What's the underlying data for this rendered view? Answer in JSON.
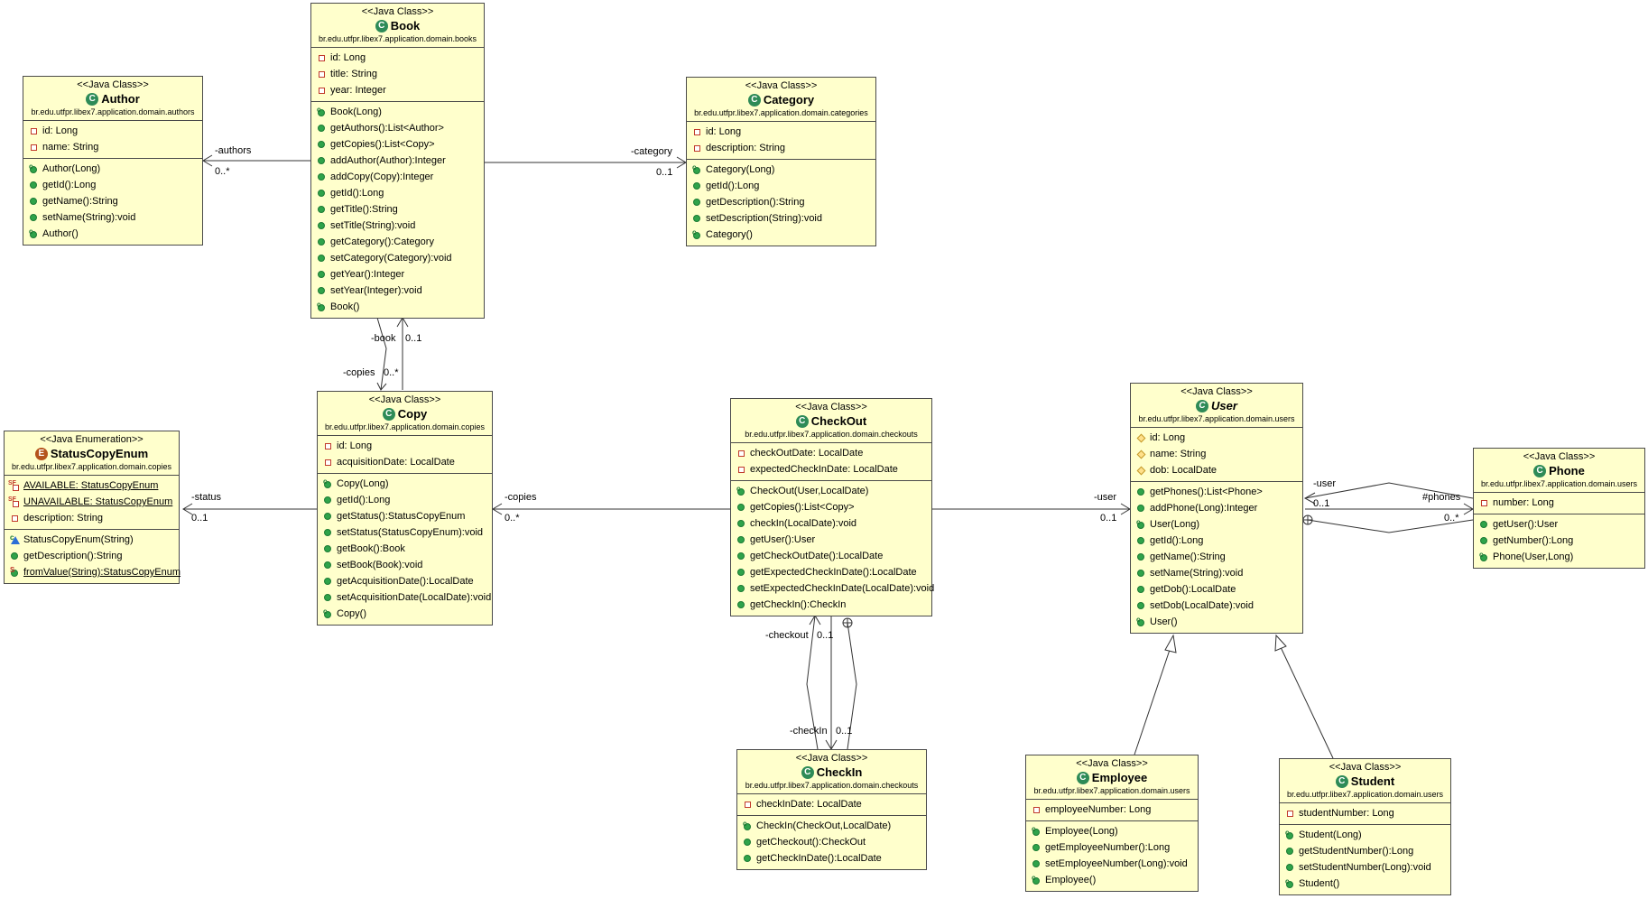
{
  "classes": [
    {
      "key": "author",
      "stereotype": "<<Java Class>>",
      "kind": "class",
      "name": "Author",
      "package": "br.edu.utfpr.libex7.application.domain.authors",
      "attributes": [
        {
          "v": "priv",
          "t": "id: Long"
        },
        {
          "v": "priv",
          "t": "name: String"
        }
      ],
      "methods": [
        {
          "v": "ctor",
          "t": "Author(Long)"
        },
        {
          "v": "pub",
          "t": "getId():Long"
        },
        {
          "v": "pub",
          "t": "getName():String"
        },
        {
          "v": "pub",
          "t": "setName(String):void"
        },
        {
          "v": "ctor",
          "t": "Author()"
        }
      ]
    },
    {
      "key": "book",
      "stereotype": "<<Java Class>>",
      "kind": "class",
      "name": "Book",
      "package": "br.edu.utfpr.libex7.application.domain.books",
      "attributes": [
        {
          "v": "priv",
          "t": "id: Long"
        },
        {
          "v": "priv",
          "t": "title: String"
        },
        {
          "v": "priv",
          "t": "year: Integer"
        }
      ],
      "methods": [
        {
          "v": "ctor",
          "t": "Book(Long)"
        },
        {
          "v": "pub",
          "t": "getAuthors():List<Author>"
        },
        {
          "v": "pub",
          "t": "getCopies():List<Copy>"
        },
        {
          "v": "pub",
          "t": "addAuthor(Author):Integer"
        },
        {
          "v": "pub",
          "t": "addCopy(Copy):Integer"
        },
        {
          "v": "pub",
          "t": "getId():Long"
        },
        {
          "v": "pub",
          "t": "getTitle():String"
        },
        {
          "v": "pub",
          "t": "setTitle(String):void"
        },
        {
          "v": "pub",
          "t": "getCategory():Category"
        },
        {
          "v": "pub",
          "t": "setCategory(Category):void"
        },
        {
          "v": "pub",
          "t": "getYear():Integer"
        },
        {
          "v": "pub",
          "t": "setYear(Integer):void"
        },
        {
          "v": "ctor",
          "t": "Book()"
        }
      ]
    },
    {
      "key": "category",
      "stereotype": "<<Java Class>>",
      "kind": "class",
      "name": "Category",
      "package": "br.edu.utfpr.libex7.application.domain.categories",
      "attributes": [
        {
          "v": "priv",
          "t": "id: Long"
        },
        {
          "v": "priv",
          "t": "description: String"
        }
      ],
      "methods": [
        {
          "v": "ctor",
          "t": "Category(Long)"
        },
        {
          "v": "pub",
          "t": "getId():Long"
        },
        {
          "v": "pub",
          "t": "getDescription():String"
        },
        {
          "v": "pub",
          "t": "setDescription(String):void"
        },
        {
          "v": "ctor",
          "t": "Category()"
        }
      ]
    },
    {
      "key": "statuscopyenum",
      "stereotype": "<<Java Enumeration>>",
      "kind": "enum",
      "name": "StatusCopyEnum",
      "package": "br.edu.utfpr.libex7.application.domain.copies",
      "attributes": [
        {
          "v": "sfield",
          "t": "AVAILABLE: StatusCopyEnum",
          "static": true
        },
        {
          "v": "sfield",
          "t": "UNAVAILABLE: StatusCopyEnum",
          "static": true
        },
        {
          "v": "priv",
          "t": "description: String"
        }
      ],
      "methods": [
        {
          "v": "pctor",
          "t": "StatusCopyEnum(String)"
        },
        {
          "v": "pub",
          "t": "getDescription():String"
        },
        {
          "v": "smeth",
          "t": "fromValue(String):StatusCopyEnum",
          "static": true
        }
      ]
    },
    {
      "key": "copy",
      "stereotype": "<<Java Class>>",
      "kind": "class",
      "name": "Copy",
      "package": "br.edu.utfpr.libex7.application.domain.copies",
      "attributes": [
        {
          "v": "priv",
          "t": "id: Long"
        },
        {
          "v": "priv",
          "t": "acquisitionDate: LocalDate"
        }
      ],
      "methods": [
        {
          "v": "ctor",
          "t": "Copy(Long)"
        },
        {
          "v": "pub",
          "t": "getId():Long"
        },
        {
          "v": "pub",
          "t": "getStatus():StatusCopyEnum"
        },
        {
          "v": "pub",
          "t": "setStatus(StatusCopyEnum):void"
        },
        {
          "v": "pub",
          "t": "getBook():Book"
        },
        {
          "v": "pub",
          "t": "setBook(Book):void"
        },
        {
          "v": "pub",
          "t": "getAcquisitionDate():LocalDate"
        },
        {
          "v": "pub",
          "t": "setAcquisitionDate(LocalDate):void"
        },
        {
          "v": "ctor",
          "t": "Copy()"
        }
      ]
    },
    {
      "key": "checkout",
      "stereotype": "<<Java Class>>",
      "kind": "class",
      "name": "CheckOut",
      "package": "br.edu.utfpr.libex7.application.domain.checkouts",
      "attributes": [
        {
          "v": "priv",
          "t": "checkOutDate: LocalDate"
        },
        {
          "v": "priv",
          "t": "expectedCheckInDate: LocalDate"
        }
      ],
      "methods": [
        {
          "v": "ctor",
          "t": "CheckOut(User,LocalDate)"
        },
        {
          "v": "pub",
          "t": "getCopies():List<Copy>"
        },
        {
          "v": "pub",
          "t": "checkIn(LocalDate):void"
        },
        {
          "v": "pub",
          "t": "getUser():User"
        },
        {
          "v": "pub",
          "t": "getCheckOutDate():LocalDate"
        },
        {
          "v": "pub",
          "t": "getExpectedCheckInDate():LocalDate"
        },
        {
          "v": "pub",
          "t": "setExpectedCheckInDate(LocalDate):void"
        },
        {
          "v": "pub",
          "t": "getCheckIn():CheckIn"
        }
      ]
    },
    {
      "key": "checkin",
      "stereotype": "<<Java Class>>",
      "kind": "class",
      "name": "CheckIn",
      "package": "br.edu.utfpr.libex7.application.domain.checkouts",
      "attributes": [
        {
          "v": "priv",
          "t": "checkInDate: LocalDate"
        }
      ],
      "methods": [
        {
          "v": "ctor",
          "t": "CheckIn(CheckOut,LocalDate)"
        },
        {
          "v": "pub",
          "t": "getCheckout():CheckOut"
        },
        {
          "v": "pub",
          "t": "getCheckInDate():LocalDate"
        }
      ]
    },
    {
      "key": "user",
      "stereotype": "<<Java Class>>",
      "kind": "abstract",
      "name": "User",
      "package": "br.edu.utfpr.libex7.application.domain.users",
      "attributes": [
        {
          "v": "prot",
          "t": "id: Long"
        },
        {
          "v": "prot",
          "t": "name: String"
        },
        {
          "v": "prot",
          "t": "dob: LocalDate"
        }
      ],
      "methods": [
        {
          "v": "pub",
          "t": "getPhones():List<Phone>"
        },
        {
          "v": "pub",
          "t": "addPhone(Long):Integer"
        },
        {
          "v": "ctor",
          "t": "User(Long)"
        },
        {
          "v": "pub",
          "t": "getId():Long"
        },
        {
          "v": "pub",
          "t": "getName():String"
        },
        {
          "v": "pub",
          "t": "setName(String):void"
        },
        {
          "v": "pub",
          "t": "getDob():LocalDate"
        },
        {
          "v": "pub",
          "t": "setDob(LocalDate):void"
        },
        {
          "v": "ctor",
          "t": "User()"
        }
      ]
    },
    {
      "key": "phone",
      "stereotype": "<<Java Class>>",
      "kind": "class",
      "name": "Phone",
      "package": "br.edu.utfpr.libex7.application.domain.users",
      "attributes": [
        {
          "v": "priv",
          "t": "number: Long"
        }
      ],
      "methods": [
        {
          "v": "pub",
          "t": "getUser():User"
        },
        {
          "v": "pub",
          "t": "getNumber():Long"
        },
        {
          "v": "ctor",
          "t": "Phone(User,Long)"
        }
      ]
    },
    {
      "key": "employee",
      "stereotype": "<<Java Class>>",
      "kind": "class",
      "name": "Employee",
      "package": "br.edu.utfpr.libex7.application.domain.users",
      "attributes": [
        {
          "v": "priv",
          "t": "employeeNumber: Long"
        }
      ],
      "methods": [
        {
          "v": "ctor",
          "t": "Employee(Long)"
        },
        {
          "v": "pub",
          "t": "getEmployeeNumber():Long"
        },
        {
          "v": "pub",
          "t": "setEmployeeNumber(Long):void"
        },
        {
          "v": "ctor",
          "t": "Employee()"
        }
      ]
    },
    {
      "key": "student",
      "stereotype": "<<Java Class>>",
      "kind": "class",
      "name": "Student",
      "package": "br.edu.utfpr.libex7.application.domain.users",
      "attributes": [
        {
          "v": "priv",
          "t": "studentNumber: Long"
        }
      ],
      "methods": [
        {
          "v": "ctor",
          "t": "Student(Long)"
        },
        {
          "v": "pub",
          "t": "getStudentNumber():Long"
        },
        {
          "v": "pub",
          "t": "setStudentNumber(Long):void"
        },
        {
          "v": "ctor",
          "t": "Student()"
        }
      ]
    }
  ],
  "edge_labels": {
    "authors_role": "-authors",
    "authors_mult": "0..*",
    "category_role": "-category",
    "category_mult": "0..1",
    "book_role": "-book",
    "book_mult": "0..1",
    "copies_role": "-copies",
    "copies_mult": "0..*",
    "status_role": "-status",
    "status_mult": "0..1",
    "co_copies_role": "-copies",
    "co_copies_mult": "0..*",
    "co_user_role": "-user",
    "co_user_mult": "0..1",
    "checkout_role": "-checkout",
    "checkout_mult": "0..1",
    "checkin_role": "-checkIn",
    "checkin_mult": "0..1",
    "phone_user_role": "-user",
    "phone_user_mult": "0..1",
    "phones_role": "#phones",
    "phones_mult": "0..*"
  },
  "colors": {
    "class_fill": "#ffffcc",
    "border": "#4a4a4a",
    "class_icon": "#2e8b57",
    "enum_icon": "#b5541c"
  }
}
